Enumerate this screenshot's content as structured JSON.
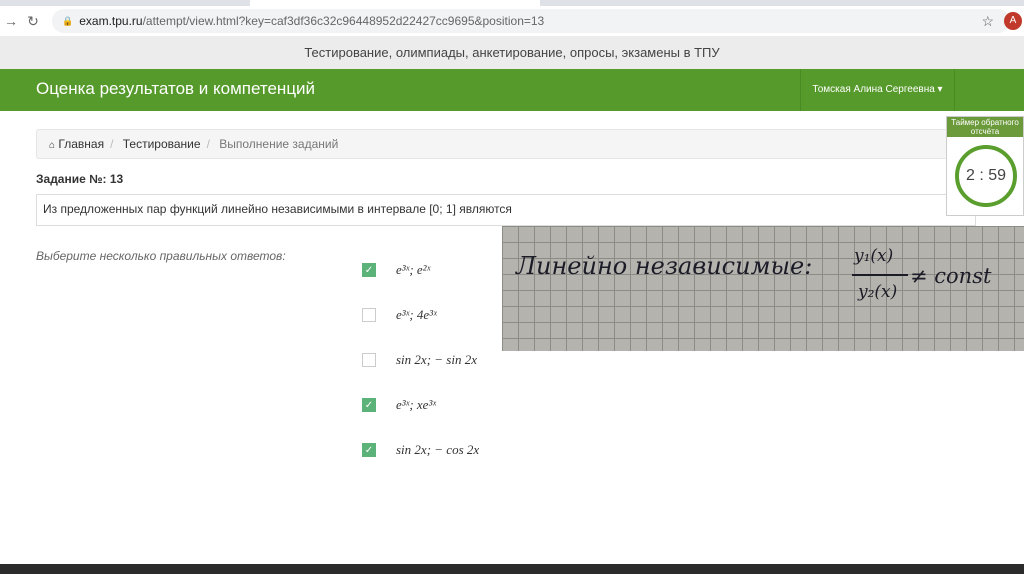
{
  "browser": {
    "url_domain": "exam.tpu.ru",
    "url_rest": "/attempt/view.html?key=caf3df36c32c96448952d22427cc9695&position=13",
    "avatar_letter": "A"
  },
  "site": {
    "tagline": "Тестирование, олимпиады, анкетирование, опросы, экзамены в ТПУ",
    "brand": "Оценка результатов и компетенций",
    "user": "Томская Алина Сергеевна ▾"
  },
  "breadcrumb": [
    "Главная",
    "Тестирование",
    "Выполнение заданий"
  ],
  "task": {
    "label": "Задание №:",
    "number": "13",
    "question": "Из предложенных пар функций линейно независимыми в интервале [0; 1] являются",
    "hint": "Выберите несколько правильных ответов:"
  },
  "options": [
    {
      "text": "e³ˣ; e²ˣ",
      "checked": true
    },
    {
      "text": "e³ˣ; 4e³ˣ",
      "checked": false
    },
    {
      "text": "sin 2x; − sin 2x",
      "checked": false
    },
    {
      "text": "e³ˣ; xe³ˣ",
      "checked": true
    },
    {
      "text": "sin 2x; − cos 2x",
      "checked": true
    }
  ],
  "note": {
    "text": "Линейно независимые:",
    "num": "y₁(x)",
    "den": "y₂(x)",
    "rel": "≠ const"
  },
  "timer": {
    "title": "Таймер обратного отсчёта",
    "value": "2 : 59"
  }
}
